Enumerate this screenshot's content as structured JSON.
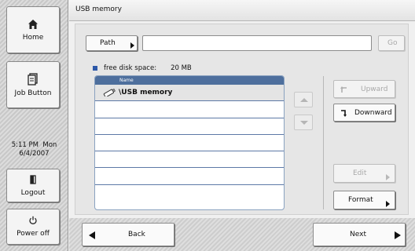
{
  "title": "USB memory",
  "sidebar": {
    "home_label": "Home",
    "job_button_label": "Job Button",
    "clock_time": "5:11 PM  Mon",
    "clock_date": "6/4/2007",
    "logout_label": "Logout",
    "power_label": "Power off"
  },
  "toolbar": {
    "path_label": "Path",
    "path_value": "",
    "go_label": "Go"
  },
  "disk": {
    "label": "free disk space:",
    "value": "20 MB"
  },
  "list": {
    "header": "Name",
    "rows": [
      "\\USB memory",
      "",
      "",
      "",
      "",
      "",
      ""
    ]
  },
  "actions": {
    "upward_label": "Upward",
    "downward_label": "Downward",
    "edit_label": "Edit",
    "format_label": "Format"
  },
  "nav": {
    "back_label": "Back",
    "next_label": "Next"
  },
  "colors": {
    "list_header": "#4e6f9d",
    "row_divider": "#5d79a6",
    "disk_marker": "#2d58a8"
  },
  "icons": [
    "home-icon",
    "job-button-icon",
    "logout-icon",
    "power-icon",
    "usb-drive-icon",
    "upward-arrow-icon",
    "downward-arrow-icon"
  ]
}
